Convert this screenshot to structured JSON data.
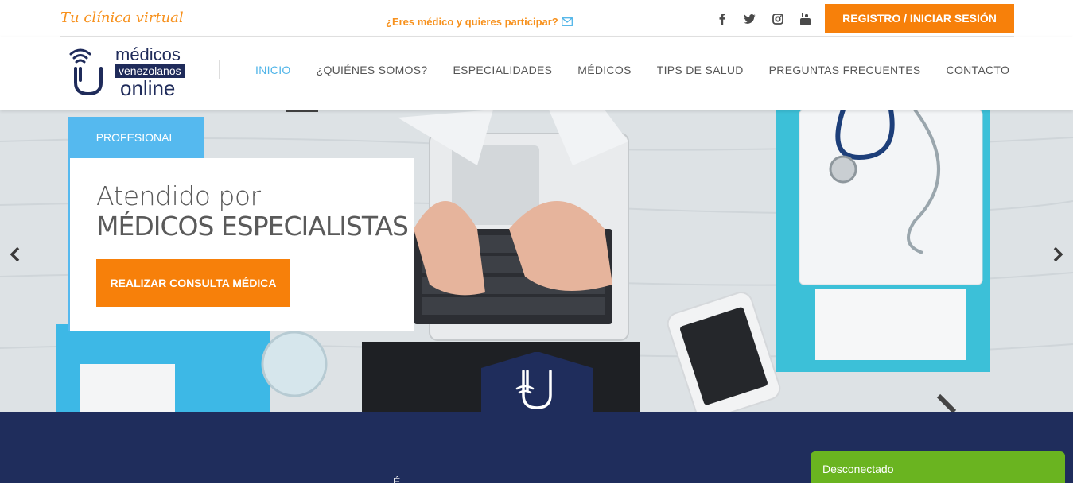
{
  "topbar": {
    "tagline": "Tu clínica virtual",
    "doctor_prompt": "¿Eres médico y quieres participar?",
    "social_icons": [
      "facebook-icon",
      "twitter-icon",
      "instagram-icon",
      "youtube-icon"
    ],
    "register_label": "REGISTRO / INICIAR SESIÓN"
  },
  "logo": {
    "line1": "médicos",
    "line2": "venezolanos",
    "line3": "online"
  },
  "nav": {
    "items": [
      "INICIO",
      "¿QUIÉNES SOMOS?",
      "ESPECIALIDADES",
      "MÉDICOS",
      "TIPS DE SALUD",
      "PREGUNTAS FRECUENTES",
      "CONTACTO"
    ],
    "active": "INICIO"
  },
  "hero": {
    "tag": "PROFESIONAL",
    "heading_line1": "Atendido por",
    "heading_line2": "MÉDICOS ESPECIALISTAS",
    "cta_label": "REALIZAR CONSULTA MÉDICA"
  },
  "bottom": {
    "partial_heading": "É"
  },
  "chat": {
    "status": "Desconectado"
  },
  "colors": {
    "accent_orange": "#f7800a",
    "accent_blue": "#55b9ef",
    "navy": "#1f2d5c",
    "chat_green": "#6ab420"
  }
}
